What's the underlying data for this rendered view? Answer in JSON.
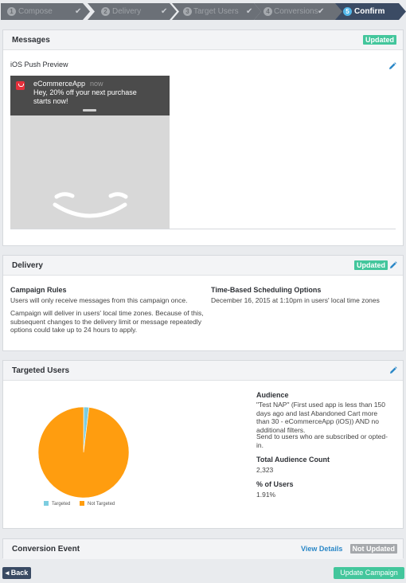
{
  "stepper": {
    "steps": [
      {
        "num": "1",
        "label": "Compose",
        "state": "done"
      },
      {
        "num": "2",
        "label": "Delivery",
        "state": "done"
      },
      {
        "num": "3",
        "label": "Target Users",
        "state": "done"
      },
      {
        "num": "4",
        "label": "Conversions",
        "state": "done"
      },
      {
        "num": "5",
        "label": "Confirm",
        "state": "active"
      }
    ],
    "check": "✔"
  },
  "messages": {
    "title": "Messages",
    "badge": "Updated",
    "preview_label": "iOS Push Preview",
    "notification": {
      "app_name": "eCommerceApp",
      "time": "now",
      "text": "Hey, 20% off your next purchase starts now!"
    }
  },
  "delivery": {
    "title": "Delivery",
    "badge": "Updated",
    "campaign_rules_label": "Campaign Rules",
    "campaign_rules_text": "Users will only receive messages from this campaign once.",
    "timezone_note": "Campaign will deliver in users' local time zones. Because of this, subsequent changes to the delivery limit or message repeatedly options could take up to 24 hours to apply.",
    "scheduling_label": "Time-Based Scheduling Options",
    "scheduling_text": "December 16, 2015 at 1:10pm in users' local time zones"
  },
  "targeted_users": {
    "title": "Targeted Users",
    "audience_label": "Audience",
    "audience_text": "\"Test NAP\" (First used app is less than 150 days ago and last Abandoned Cart more than 30 - eCommerceApp (iOS)) AND no additional filters.",
    "subscription_text": "Send to users who are subscribed or opted-in.",
    "total_label": "Total Audience Count",
    "total_value": "2,323",
    "percent_label": "% of Users",
    "percent_value": "1.91%",
    "chart_data": {
      "type": "pie",
      "slices": [
        {
          "label": "Targeted",
          "value": 1.91,
          "color": "#7ccde0"
        },
        {
          "label": "Not Targeted",
          "value": 98.09,
          "color": "#ff9d0f"
        }
      ],
      "legend_position": "bottom"
    }
  },
  "conversion": {
    "title": "Conversion Event",
    "view_details": "View Details",
    "badge": "Not Updated"
  },
  "footer": {
    "back": "◂ Back",
    "update": "Update Campaign"
  },
  "colors": {
    "accent": "#43c69c",
    "link": "#2a87c7",
    "stepper_bg": "#6b7077",
    "stepper_active": "#3b4b64"
  }
}
